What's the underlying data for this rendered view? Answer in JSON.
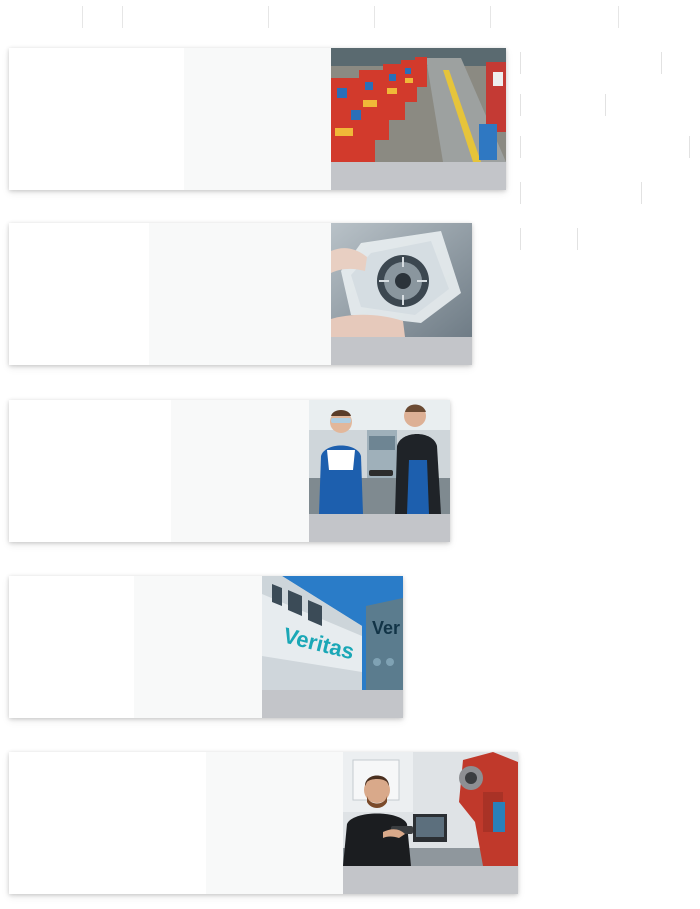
{
  "top_nav": {
    "tabs": [
      "",
      "",
      "",
      "",
      "",
      ""
    ]
  },
  "side_links": [
    "",
    "",
    "",
    "",
    ""
  ],
  "cards": [
    {
      "image": "warehouse-racks-photo",
      "caption": ""
    },
    {
      "image": "gear-in-foil-photo",
      "caption": ""
    },
    {
      "image": "two-technicians-photo",
      "caption": ""
    },
    {
      "image": "veritas-building-photo",
      "caption": "",
      "building_sign": "Veritas",
      "sign_fragment": "Ver"
    },
    {
      "image": "man-with-robot-arm-photo",
      "caption": ""
    }
  ],
  "colors": {
    "card_shadow": "#cfcfcf",
    "caption_bar": "#c3c5c9",
    "panel_tint": "#f8f9f9",
    "brand_teal": "#1aa7b6"
  }
}
